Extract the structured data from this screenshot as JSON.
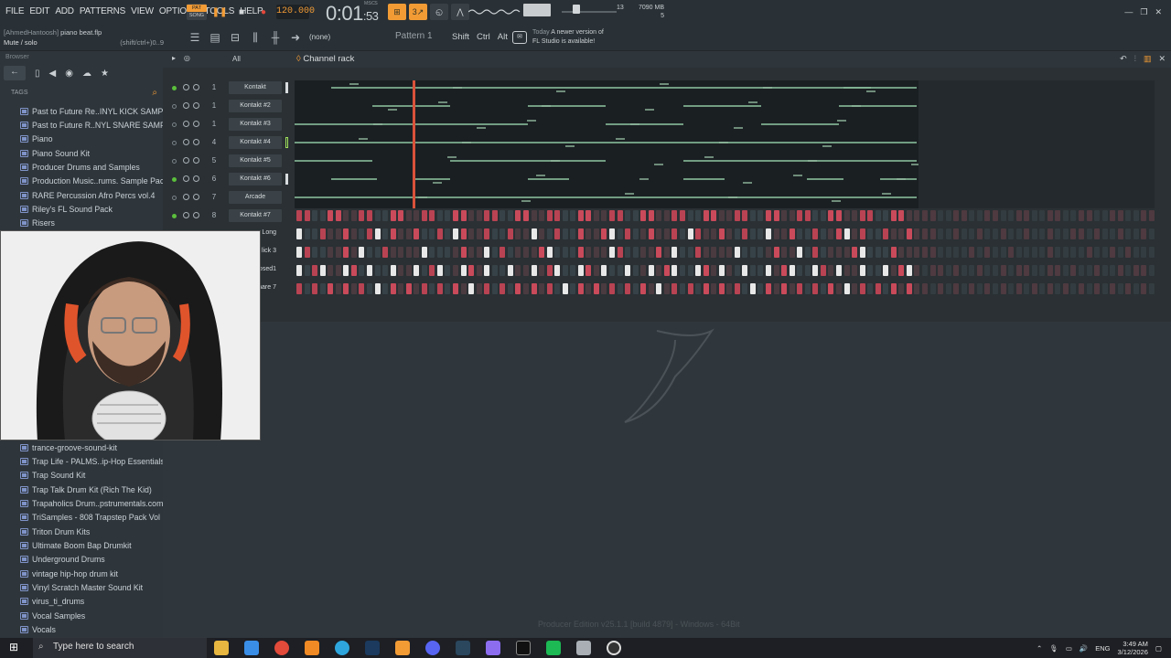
{
  "menu": [
    "FILE",
    "EDIT",
    "ADD",
    "PATTERNS",
    "VIEW",
    "OPTIONS",
    "TOOLS",
    "HELP"
  ],
  "project": {
    "user": "[AhmedHantoosh]",
    "file": "piano beat.flp"
  },
  "hint": {
    "label": "Mute / solo",
    "shortcut": "(shift/ctrl+)0..9"
  },
  "transport": {
    "pat": "PAT",
    "song": "SONG",
    "tempo": "120.000",
    "time_main": "0:01",
    "time_sub": ":53",
    "time_unit": "M:S:CS"
  },
  "monitor": {
    "cpu_num": "13",
    "memory": "7090 MB",
    "poly": "5"
  },
  "toolbar": {
    "pattern_none": "(none)",
    "pattern_name": "Pattern 1",
    "keys": [
      "Shift",
      "Ctrl",
      "Alt"
    ]
  },
  "news": {
    "today": "Today",
    "line1": "A newer version of",
    "line2": "FL Studio is available!"
  },
  "browser": {
    "header": "Browser",
    "tags_label": "TAGS",
    "items_top": [
      "Past to Future Re..INYL KICK SAMPLES",
      "Past to Future R..NYL SNARE SAMPLES",
      "Piano",
      "Piano Sound Kit",
      "Producer Drums and Samples",
      "Production Music..rums. Sample Pack",
      "RARE Percussion Afro Percs vol.4",
      "Riley's FL Sound Pack",
      "Risers"
    ],
    "items_bottom": [
      "trance-groove-sound-kit",
      "Trap Life - PALMS..ip-Hop Essentials 1",
      "Trap Sound Kit",
      "Trap Talk Drum Kit (Rich The Kid)",
      "Trapaholics Drum..pstrumentals.com)",
      "TriSamples - 808 Trapstep Pack Vol 1",
      "Triton Drum Kits",
      "Ultimate Boom Bap Drumkit",
      "Underground Drums",
      "vintage hip-hop drum kit",
      "Vinyl Scratch Master Sound Kit",
      "virus_ti_drums",
      "Vocal Samples",
      "Vocals"
    ]
  },
  "rack": {
    "filter": "All",
    "title": "Channel rack",
    "channels": [
      {
        "num": "1",
        "name": "Kontakt",
        "on": true
      },
      {
        "num": "1",
        "name": "Kontakt #2",
        "on": false
      },
      {
        "num": "1",
        "name": "Kontakt #3",
        "on": false
      },
      {
        "num": "4",
        "name": "Kontakt #4",
        "on": false
      },
      {
        "num": "5",
        "name": "Kontakt #5",
        "on": false
      },
      {
        "num": "6",
        "name": "Kontakt #6",
        "on": true
      },
      {
        "num": "7",
        "name": "Arcade",
        "on": false
      },
      {
        "num": "8",
        "name": "Kontakt #7",
        "on": true
      }
    ],
    "step_rows_partial": [
      "Long",
      "lick 3",
      "osed1",
      "nare 7"
    ]
  },
  "edition": "Producer Edition v25.1.1 [build 4879] - Windows - 64Bit",
  "taskbar": {
    "search_placeholder": "Type here to search",
    "lang": "ENG",
    "time": "3:49 AM",
    "date": "3/12/2026"
  },
  "colors": {
    "accent": "#f29b35",
    "step_on": "#c94a5a",
    "step_white": "#e8e8e8",
    "led_on": "#5bbf3c"
  }
}
